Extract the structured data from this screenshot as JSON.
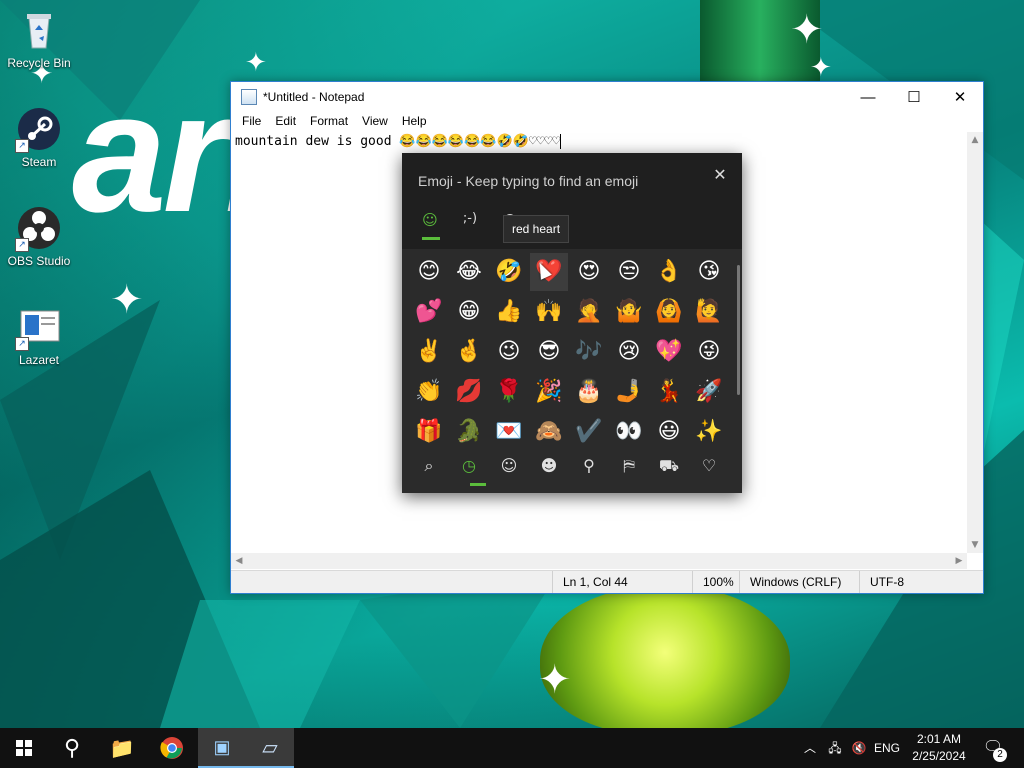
{
  "desktop": {
    "brand_text": "ari",
    "icons": [
      {
        "label": "Recycle Bin",
        "icon": "recycle-bin-icon"
      },
      {
        "label": "Steam",
        "icon": "steam-icon"
      },
      {
        "label": "OBS Studio",
        "icon": "obs-studio-icon"
      },
      {
        "label": "Lazaret",
        "icon": "lazaret-icon"
      }
    ]
  },
  "notepad": {
    "title": "*Untitled - Notepad",
    "controls": {
      "minimize": "—",
      "maximize": "☐",
      "close": "✕"
    },
    "menu": [
      "File",
      "Edit",
      "Format",
      "View",
      "Help"
    ],
    "content": "mountain dew is good 😂😂😂😂😂😂🤣🤣♡♡♡♡",
    "status": {
      "position": "Ln 1, Col 44",
      "zoom": "100%",
      "line_ending": "Windows (CRLF)",
      "encoding": "UTF-8"
    }
  },
  "emoji_panel": {
    "title": "Emoji - Keep typing to find an emoji",
    "close": "✕",
    "tabs": [
      "☺",
      ";-)",
      "Ω"
    ],
    "tooltip": "red heart",
    "grid": [
      [
        "😊",
        "😂",
        "🤣",
        "❤️",
        "😍",
        "😒",
        "👌",
        "😘"
      ],
      [
        "💕",
        "😁",
        "👍",
        "🙌",
        "🤦",
        "🤷",
        "🙆",
        "🙋"
      ],
      [
        "✌️",
        "🤞",
        "😉",
        "😎",
        "🎶",
        "😢",
        "💖",
        "😜"
      ],
      [
        "👏",
        "💋",
        "🌹",
        "🎉",
        "🎂",
        "🤳",
        "💃",
        "🚀"
      ],
      [
        "🎁",
        "🐊",
        "💌",
        "🙈",
        "✔️",
        "👀",
        "😃",
        "✨"
      ]
    ],
    "categories": [
      "⌕",
      "◷",
      "☺",
      "☻",
      "⚲",
      "⛿",
      "⛟",
      "♡"
    ]
  },
  "taskbar": {
    "start": "Start",
    "search": "⚲",
    "apps": [
      {
        "name": "file-explorer-icon",
        "glyph": "📁"
      },
      {
        "name": "chrome-icon",
        "glyph": "◉"
      },
      {
        "name": "app-icon",
        "glyph": "▣"
      },
      {
        "name": "notepad-taskbar-icon",
        "glyph": "▱"
      }
    ],
    "tray": {
      "chevron": "︿",
      "network": "🖧",
      "volume": "🔇",
      "language": "ENG",
      "time": "2:01 AM",
      "date": "2/25/2024",
      "notifications": "🗨",
      "notification_count": "2"
    }
  }
}
